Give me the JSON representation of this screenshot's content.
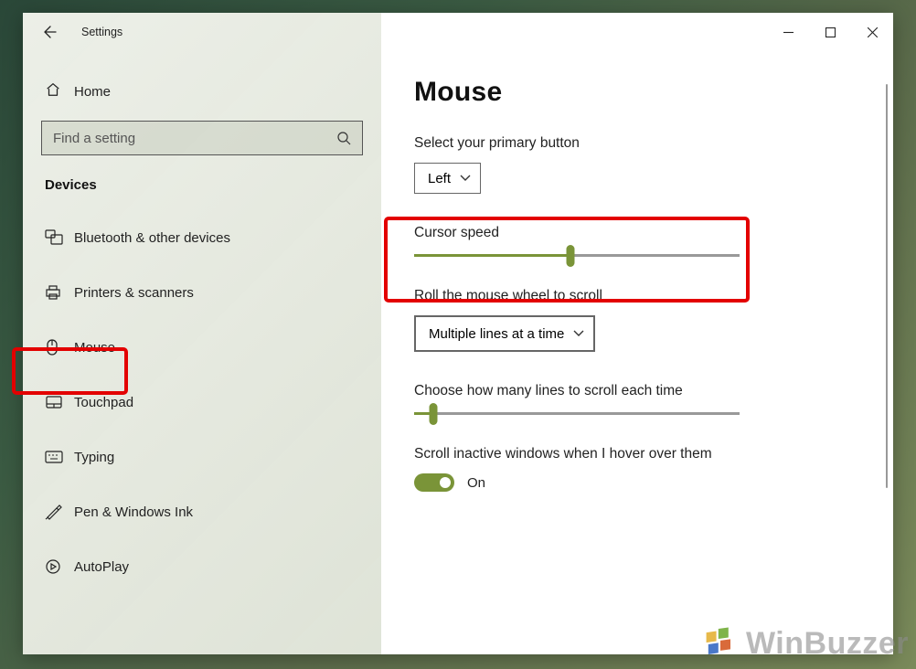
{
  "window": {
    "title": "Settings"
  },
  "home": {
    "label": "Home"
  },
  "search": {
    "placeholder": "Find a setting"
  },
  "category": "Devices",
  "nav": [
    {
      "label": "Bluetooth & other devices"
    },
    {
      "label": "Printers & scanners"
    },
    {
      "label": "Mouse"
    },
    {
      "label": "Touchpad"
    },
    {
      "label": "Typing"
    },
    {
      "label": "Pen & Windows Ink"
    },
    {
      "label": "AutoPlay"
    }
  ],
  "page": {
    "title": "Mouse",
    "primary_button_label": "Select your primary button",
    "primary_button_value": "Left",
    "cursor_speed_label": "Cursor speed",
    "cursor_speed_value": 48,
    "scroll_mode_label": "Roll the mouse wheel to scroll",
    "scroll_mode_value": "Multiple lines at a time",
    "lines_label": "Choose how many lines to scroll each time",
    "lines_value": 6,
    "inactive_label": "Scroll inactive windows when I hover over them",
    "inactive_toggle_state": "On"
  },
  "watermark": "WinBuzzer"
}
